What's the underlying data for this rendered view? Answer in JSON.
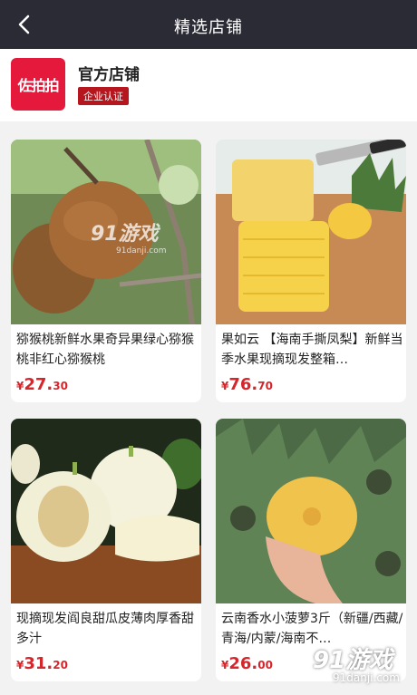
{
  "header": {
    "title": "精选店铺"
  },
  "shop": {
    "logo_text": "佐拍拍",
    "name": "官方店铺",
    "badge": "企业认证"
  },
  "products": [
    {
      "title": "猕猴桃新鲜水果奇异果绿心猕猴桃非红心猕猴桃",
      "price_currency": "¥",
      "price_int": "27.",
      "price_dec": "30"
    },
    {
      "title": "果如云 【海南手撕凤梨】新鲜当季水果现摘现发整箱…",
      "price_currency": "¥",
      "price_int": "76.",
      "price_dec": "70"
    },
    {
      "title": "现摘现发阎良甜瓜皮薄肉厚香甜多汁",
      "price_currency": "¥",
      "price_int": "31.",
      "price_dec": "20"
    },
    {
      "title": "云南香水小菠萝3斤（新疆/西藏/青海/内蒙/海南不…",
      "price_currency": "¥",
      "price_int": "26.",
      "price_dec": "00"
    }
  ],
  "watermark": {
    "logo": "91游戏",
    "url": "91danji.com",
    "corner_logo": "91游戏",
    "corner_url": "91danji.com"
  }
}
